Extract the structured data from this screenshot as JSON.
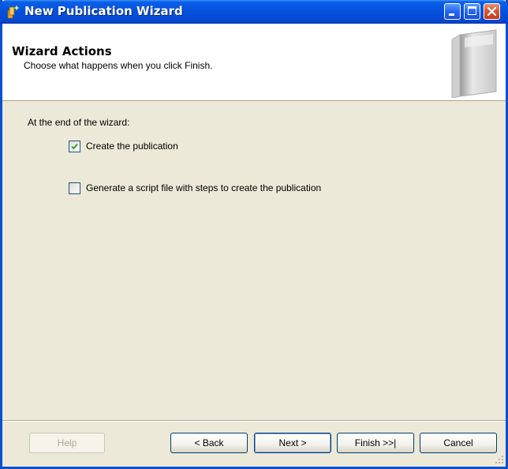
{
  "window": {
    "title": "New Publication Wizard"
  },
  "header": {
    "title": "Wizard Actions",
    "subtitle": "Choose what happens when you click Finish."
  },
  "body": {
    "intro": "At the end of the wizard:",
    "options": [
      {
        "label": "Create the publication",
        "checked": true
      },
      {
        "label": "Generate a script file with steps to create the publication",
        "checked": false
      }
    ]
  },
  "buttons": {
    "help": "Help",
    "back": "< Back",
    "next": "Next >",
    "finish": "Finish >>|",
    "cancel": "Cancel"
  },
  "icons": {
    "app": "wizard-app-icon",
    "header": "book-graphic-icon"
  },
  "colors": {
    "titlebar": "#0553DE",
    "window_bg": "#ECE9D8",
    "header_bg": "#FFFFFF",
    "close_button": "#D6542E"
  }
}
